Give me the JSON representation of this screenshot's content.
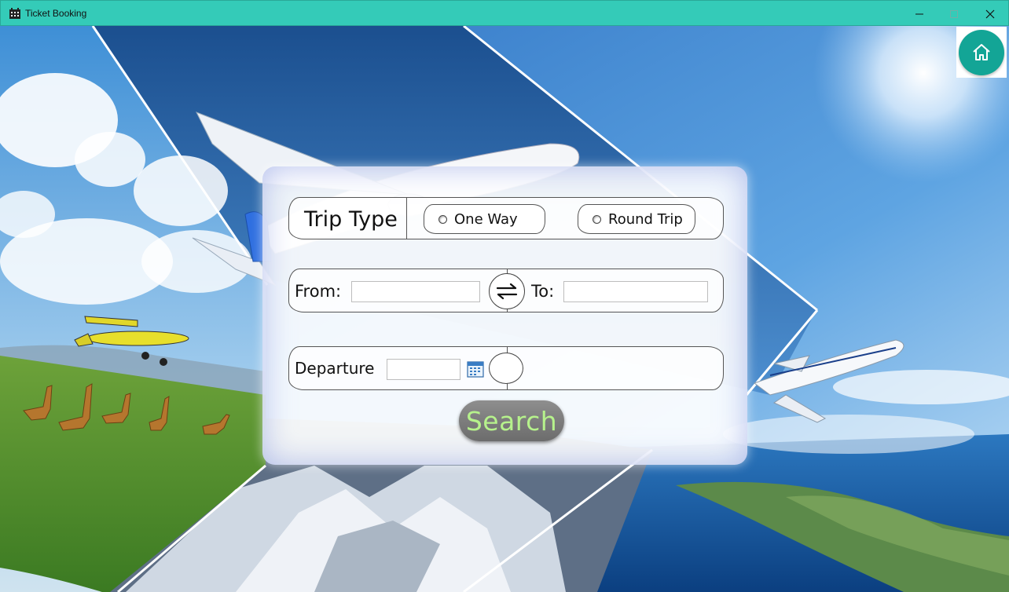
{
  "window": {
    "title": "Ticket Booking",
    "icon": "calendar-grid-icon",
    "controls": [
      "minimize-icon",
      "maximize-icon",
      "close-icon"
    ]
  },
  "home_button": {
    "icon": "home-icon",
    "color": "#13a596"
  },
  "trip_type": {
    "label": "Trip Type",
    "options": [
      {
        "label": "One Way",
        "selected": false
      },
      {
        "label": "Round Trip",
        "selected": false
      }
    ]
  },
  "route": {
    "from_label": "From:",
    "from_value": "",
    "to_label": "To:",
    "to_value": "",
    "swap_icon": "swap-arrows-icon"
  },
  "departure": {
    "label": "Departure",
    "date_value": "",
    "calendar_icon": "calendar-icon"
  },
  "search": {
    "label": "Search",
    "text_color": "#b6f28c"
  },
  "colors": {
    "titlebar": "#34cbb8",
    "accent": "#13a596"
  }
}
